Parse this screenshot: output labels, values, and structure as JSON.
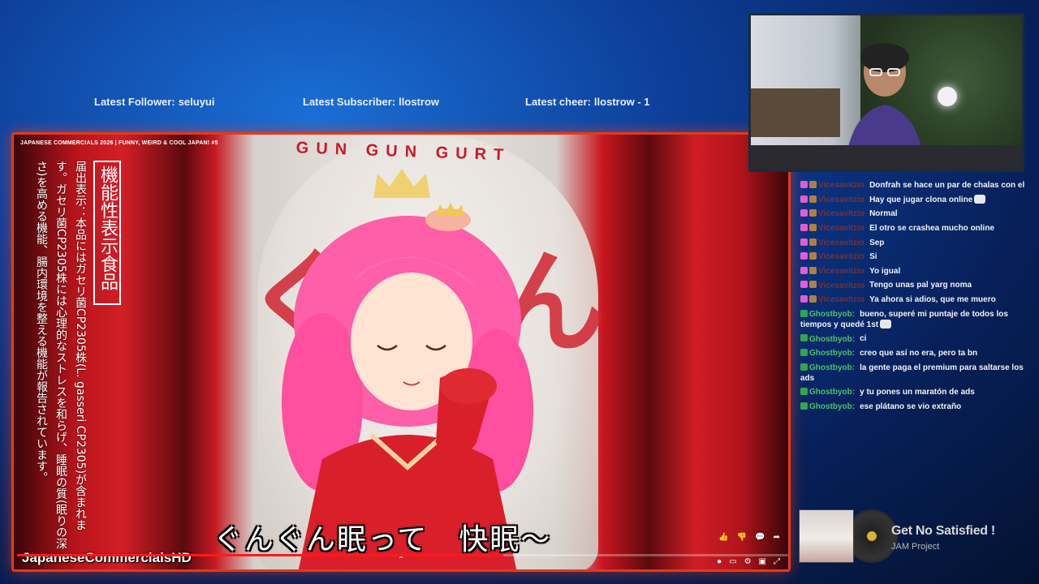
{
  "alerts": {
    "follower_label": "Latest Follower:",
    "follower_value": "seluyui",
    "subscriber_label": "Latest Subscriber:",
    "subscriber_value": "llostrow",
    "cheer_label": "Latest cheer:",
    "cheer_value": "llostrow - 1"
  },
  "video": {
    "title": "JAPANESE COMMERCIALS 2026 | FUNNY, WEIRD & COOL JAPAN! #5",
    "can_brand": "GUN GUN GURT",
    "can_big_left": "ぐん",
    "can_big_right": "ん",
    "vertical_box": "機能性表示食品",
    "vertical_text": "届出表示：本品にはガセリ菌CP2305株(L. gasseri CP2305)が含まれます。ガセリ菌CP2305株には心理的なストレスを和らげ、睡眠の質(眠りの深さ)を高める機能、腸内環境を整える機能が報告されています。",
    "subtitle": "ぐんぐん眠って　快眠〜",
    "channel_watermark": "JapaneseCommercialsHD",
    "progress_fraction": 0.63,
    "colors": {
      "border": "#e23a1a",
      "progress": "#ff1a1a"
    }
  },
  "chat": {
    "messages": [
      {
        "user": "Vicesavitzio",
        "user_style": "hidden",
        "badges": [
          "pink",
          "orange"
        ],
        "text": "Donfrah se hace un par de chalas con el"
      },
      {
        "user": "Vicesavitzio",
        "user_style": "hidden",
        "badges": [
          "pink",
          "orange"
        ],
        "text": "Hay que jugar clona online",
        "emote": true
      },
      {
        "user": "Vicesavitzio",
        "user_style": "hidden",
        "badges": [
          "pink",
          "orange"
        ],
        "text": "Normal"
      },
      {
        "user": "Vicesavitzio",
        "user_style": "hidden",
        "badges": [
          "pink",
          "orange"
        ],
        "text": "El otro se crashea mucho online"
      },
      {
        "user": "Vicesavitzio",
        "user_style": "hidden",
        "badges": [
          "pink",
          "orange"
        ],
        "text": "Sep"
      },
      {
        "user": "Vicesavitzio",
        "user_style": "hidden",
        "badges": [
          "pink",
          "orange"
        ],
        "text": "Si"
      },
      {
        "user": "Vicesavitzio",
        "user_style": "hidden",
        "badges": [
          "pink",
          "orange"
        ],
        "text": "Yo igual"
      },
      {
        "user": "Vicesavitzio",
        "user_style": "hidden",
        "badges": [
          "pink",
          "orange"
        ],
        "text": "Tengo unas pal yarg noma"
      },
      {
        "user": "Vicesavitzio",
        "user_style": "hidden",
        "badges": [
          "pink",
          "orange"
        ],
        "text": "Ya ahora si adios, que me muero"
      },
      {
        "user": "Ghostbyob:",
        "user_style": "ghost",
        "badges": [
          "green"
        ],
        "text": "bueno, superé mi puntaje de todos los tiempos y quedé 1st",
        "emote": true
      },
      {
        "user": "Ghostbyob:",
        "user_style": "ghost",
        "badges": [
          "green"
        ],
        "text": "ci"
      },
      {
        "user": "Ghostbyob:",
        "user_style": "ghost",
        "badges": [
          "green"
        ],
        "text": "creo que así no era, pero ta bn"
      },
      {
        "user": "Ghostbyob:",
        "user_style": "ghost",
        "badges": [
          "green"
        ],
        "text": "la gente paga el premium para saltarse los ads"
      },
      {
        "user": "Ghostbyob:",
        "user_style": "ghost",
        "badges": [
          "green"
        ],
        "text": "y tu pones un maratón de ads"
      },
      {
        "user": "Ghostbyob:",
        "user_style": "ghost",
        "badges": [
          "green"
        ],
        "text": "ese plátano se vio extraño"
      }
    ]
  },
  "now_playing": {
    "title": "Get No Satisfied !",
    "artist": "JAM Project"
  }
}
